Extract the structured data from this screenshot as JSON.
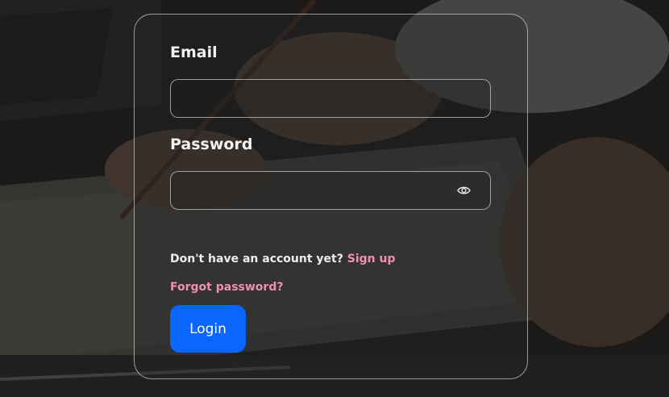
{
  "form": {
    "email_label": "Email",
    "email_value": "",
    "password_label": "Password",
    "password_value": "",
    "signup_prompt": "Don't have an account yet? ",
    "signup_link": "Sign up",
    "forgot_link": "Forgot password?",
    "login_label": "Login",
    "password_toggle_icon": "eye-icon"
  },
  "colors": {
    "accent": "#0a66ff",
    "link": "#f08fb3",
    "card_border": "#9a9a9a"
  }
}
